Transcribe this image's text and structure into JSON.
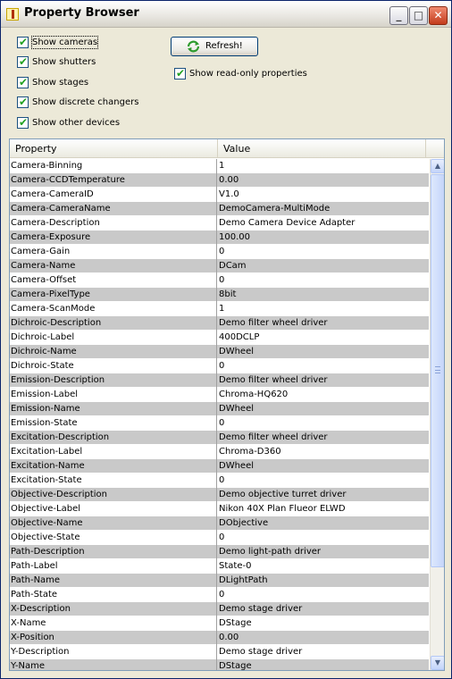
{
  "window": {
    "title": "Property Browser"
  },
  "options": {
    "show_cameras": {
      "label": "Show cameras",
      "checked": true
    },
    "show_shutters": {
      "label": "Show shutters",
      "checked": true
    },
    "show_stages": {
      "label": "Show stages",
      "checked": true
    },
    "show_discrete_changers": {
      "label": "Show discrete changers",
      "checked": true
    },
    "show_other_devices": {
      "label": "Show other devices",
      "checked": true
    },
    "show_readonly": {
      "label": "Show read-only properties",
      "checked": true
    }
  },
  "toolbar": {
    "refresh_label": "Refresh!"
  },
  "table": {
    "columns": [
      "Property",
      "Value"
    ],
    "rows": [
      [
        "Camera-Binning",
        "1"
      ],
      [
        "Camera-CCDTemperature",
        "0.00"
      ],
      [
        "Camera-CameraID",
        "V1.0"
      ],
      [
        "Camera-CameraName",
        "DemoCamera-MultiMode"
      ],
      [
        "Camera-Description",
        "Demo Camera Device Adapter"
      ],
      [
        "Camera-Exposure",
        "100.00"
      ],
      [
        "Camera-Gain",
        "0"
      ],
      [
        "Camera-Name",
        "DCam"
      ],
      [
        "Camera-Offset",
        "0"
      ],
      [
        "Camera-PixelType",
        "8bit"
      ],
      [
        "Camera-ScanMode",
        "1"
      ],
      [
        "Dichroic-Description",
        "Demo filter wheel driver"
      ],
      [
        "Dichroic-Label",
        "400DCLP"
      ],
      [
        "Dichroic-Name",
        "DWheel"
      ],
      [
        "Dichroic-State",
        "0"
      ],
      [
        "Emission-Description",
        "Demo filter wheel driver"
      ],
      [
        "Emission-Label",
        "Chroma-HQ620"
      ],
      [
        "Emission-Name",
        "DWheel"
      ],
      [
        "Emission-State",
        "0"
      ],
      [
        "Excitation-Description",
        "Demo filter wheel driver"
      ],
      [
        "Excitation-Label",
        "Chroma-D360"
      ],
      [
        "Excitation-Name",
        "DWheel"
      ],
      [
        "Excitation-State",
        "0"
      ],
      [
        "Objective-Description",
        "Demo objective turret driver"
      ],
      [
        "Objective-Label",
        "Nikon 40X Plan Flueor ELWD"
      ],
      [
        "Objective-Name",
        "DObjective"
      ],
      [
        "Objective-State",
        "0"
      ],
      [
        "Path-Description",
        "Demo light-path driver"
      ],
      [
        "Path-Label",
        "State-0"
      ],
      [
        "Path-Name",
        "DLightPath"
      ],
      [
        "Path-State",
        "0"
      ],
      [
        "X-Description",
        "Demo stage driver"
      ],
      [
        "X-Name",
        "DStage"
      ],
      [
        "X-Position",
        "0.00"
      ],
      [
        "Y-Description",
        "Demo stage driver"
      ],
      [
        "Y-Name",
        "DStage"
      ]
    ]
  }
}
